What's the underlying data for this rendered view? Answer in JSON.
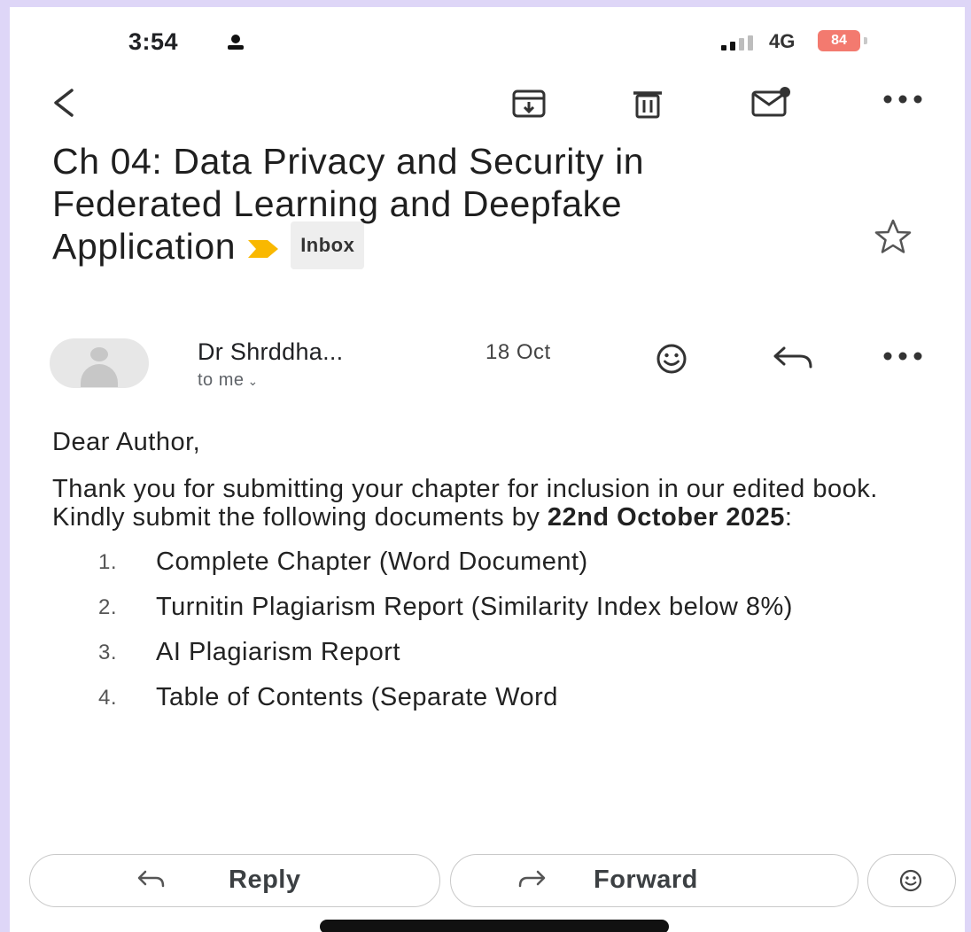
{
  "status_bar": {
    "time": "3:54",
    "network": "4G",
    "battery": "84"
  },
  "toolbar": {
    "icons": [
      "back-arrow-icon",
      "archive-icon",
      "trash-icon",
      "mark-unread-icon",
      "more-icon"
    ]
  },
  "email": {
    "subject": "Ch 04: Data Privacy and Security in Federated Learning and Deepfake Application",
    "label": "Inbox",
    "sender": "Dr Shrddha...",
    "date": "18 Oct",
    "recipient": "to me",
    "body": {
      "greeting": "Dear Author,",
      "intro": "Thank you for submitting your chapter for inclusion in our edited book. Kindly submit the following documents by",
      "deadline": "22nd October 2025",
      "deadline_suffix": ":",
      "items": [
        {
          "num": "1.",
          "text": "Complete Chapter (Word Document)"
        },
        {
          "num": "2.",
          "text": "Turnitin Plagiarism Report (Similarity Index below 8%)"
        },
        {
          "num": "3.",
          "text": "AI Plagiarism Report"
        },
        {
          "num": "4.",
          "text": "Table of Contents (Separate Word"
        }
      ]
    }
  },
  "actions": {
    "reply": "Reply",
    "forward": "Forward"
  },
  "colors": {
    "background": "#ded6f7",
    "importance_marker": "#f9b800",
    "battery": "#f37a6f"
  }
}
